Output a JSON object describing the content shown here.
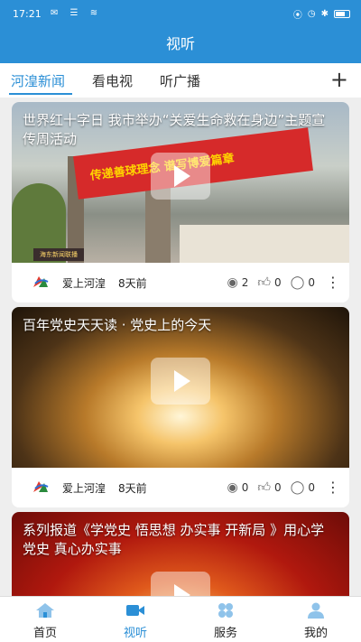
{
  "status_bar": {
    "time": "17:21"
  },
  "header": {
    "title": "视听"
  },
  "tabs": [
    {
      "label": "河湟新闻",
      "active": true
    },
    {
      "label": "看电视",
      "active": false
    },
    {
      "label": "听广播",
      "active": false
    }
  ],
  "cards": [
    {
      "title": "世界红十字日      我市举办“关爱生命救在身边”主题宣传周活动",
      "banner_text": "传递善球理念 谱写博爱篇章",
      "tv_logo": "海东新闻联播",
      "source": "爱上河湟",
      "time_ago": "8天前",
      "views": "2",
      "likes": "0",
      "comments": "0"
    },
    {
      "title": "百年党史天天读 · 党史上的今天",
      "source": "爱上河湟",
      "time_ago": "8天前",
      "views": "0",
      "likes": "0",
      "comments": "0"
    },
    {
      "title": "系列报道《学党史      悟思想      办实事      开新局 》用心学党史      真心办实事"
    }
  ],
  "bottom_nav": [
    {
      "label": "首页",
      "icon": "home-icon",
      "active": false
    },
    {
      "label": "视听",
      "icon": "video-camera-icon",
      "active": true
    },
    {
      "label": "服务",
      "icon": "grid-icon",
      "active": false
    },
    {
      "label": "我的",
      "icon": "user-icon",
      "active": false
    }
  ],
  "colors": {
    "accent": "#2b8fd6",
    "background": "#eeeeee"
  }
}
